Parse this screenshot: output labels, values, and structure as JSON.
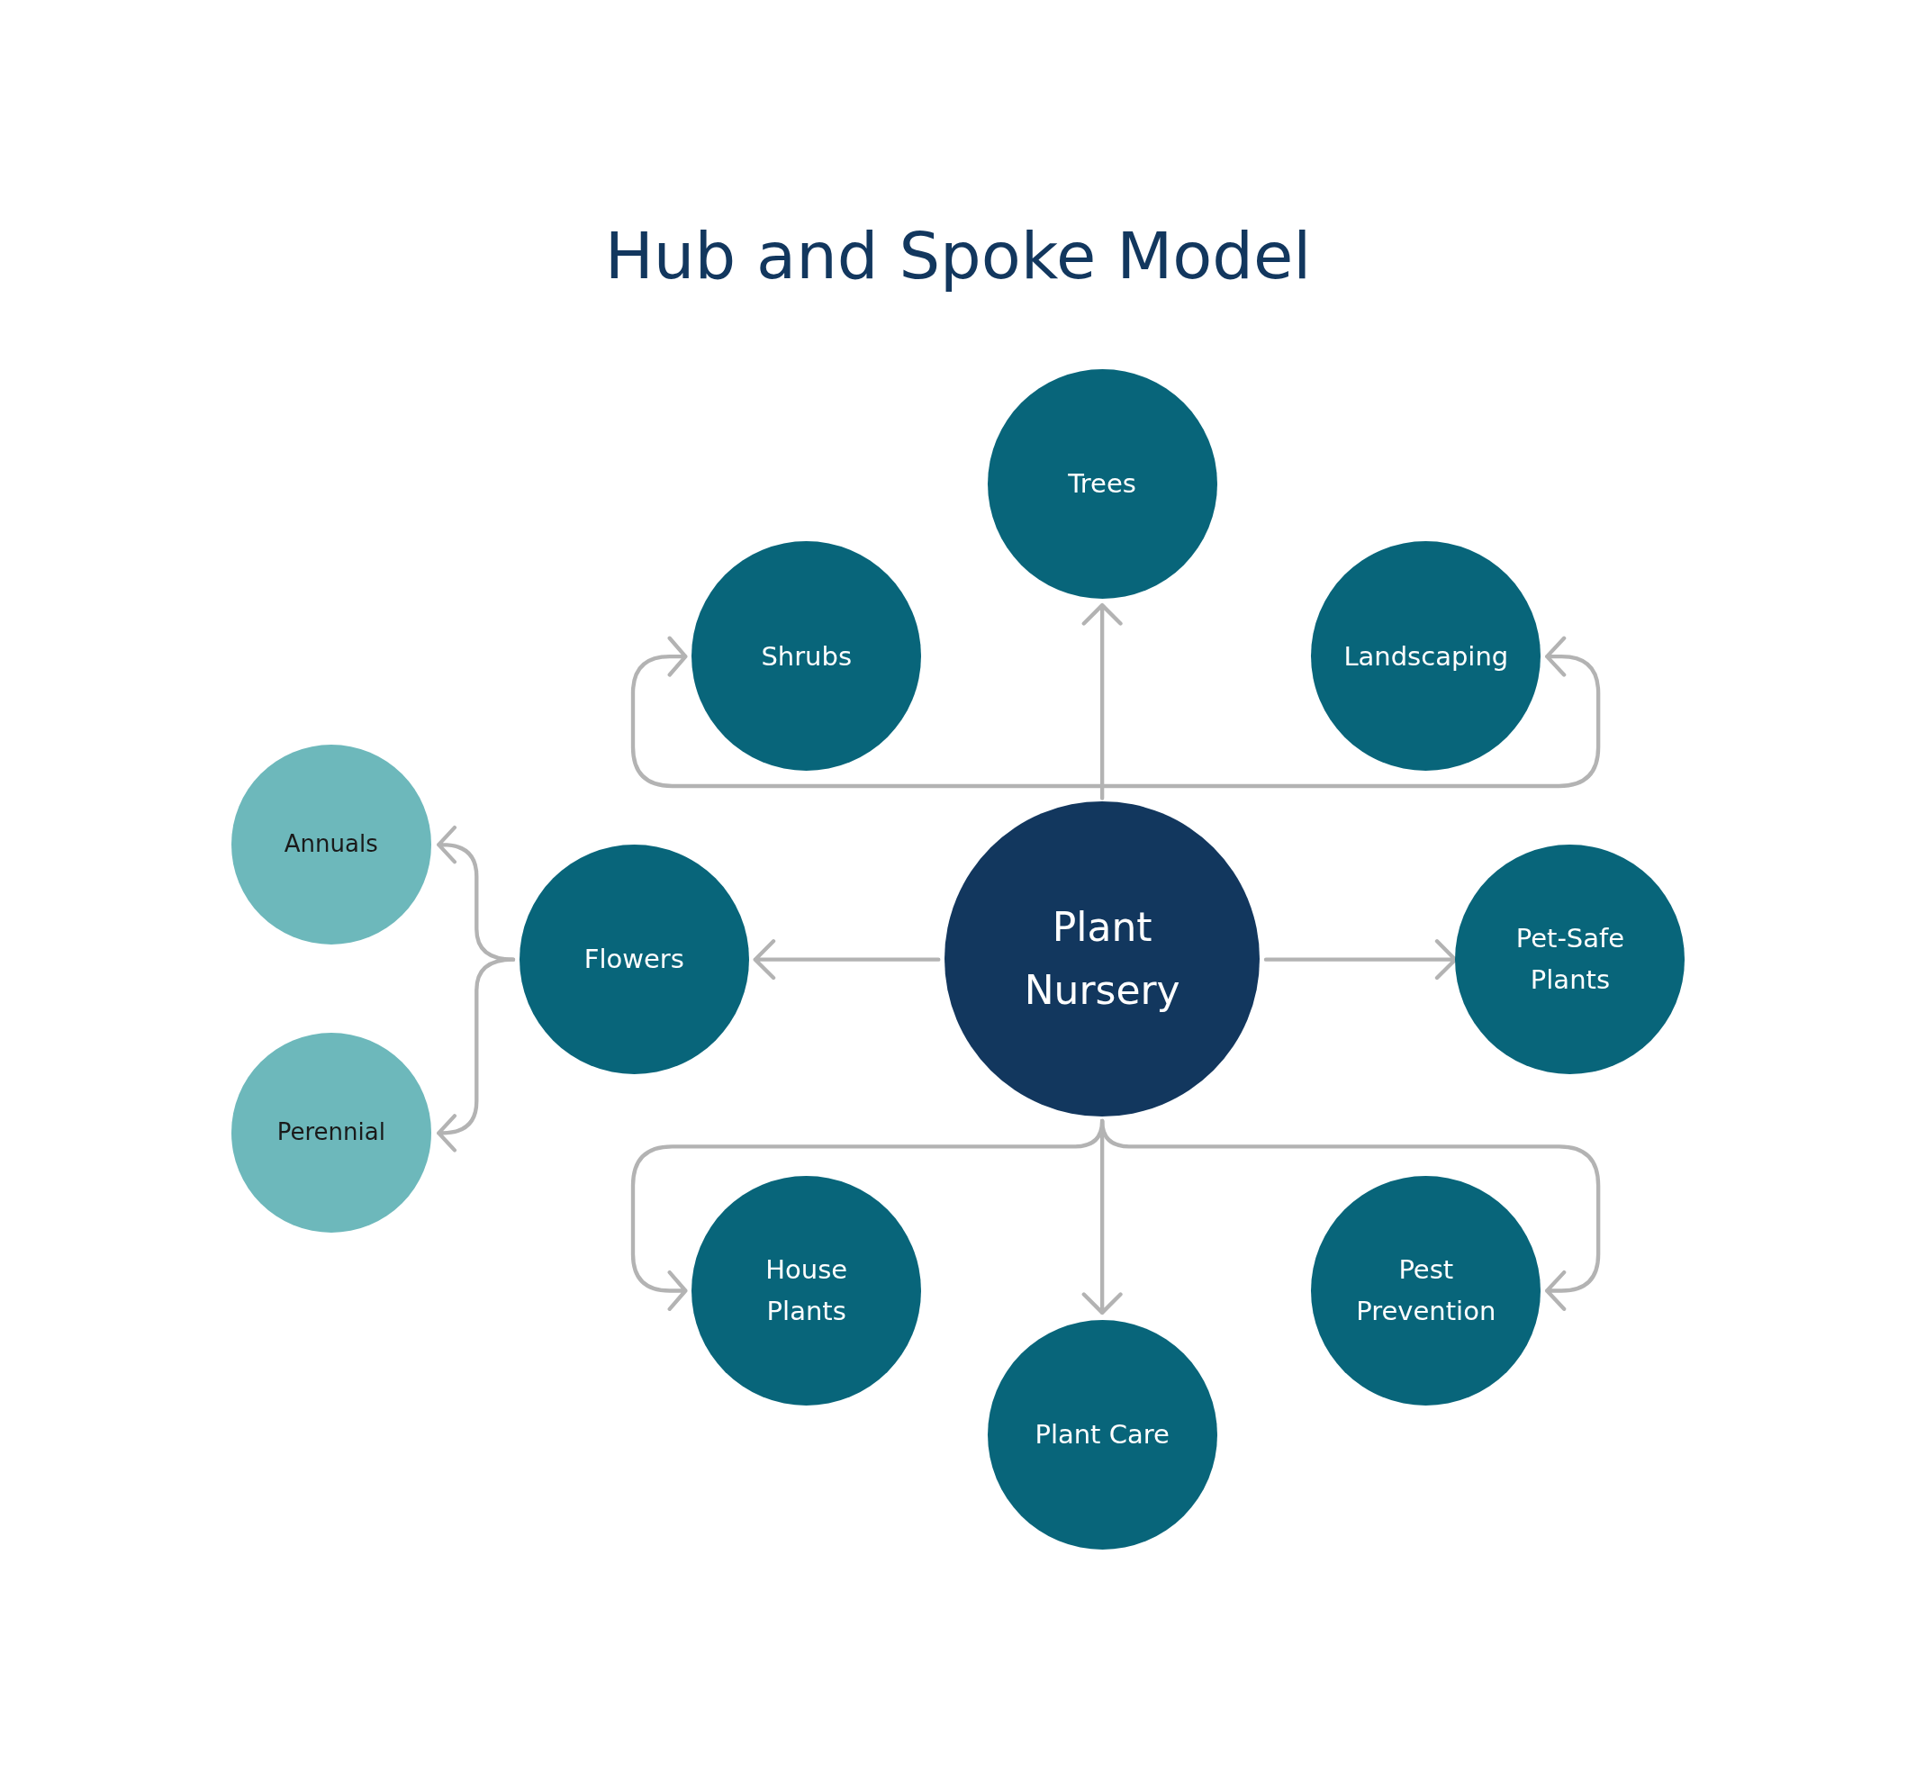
{
  "title": "Hub and Spoke Model",
  "hub": {
    "label": "Plant\nNursery",
    "color": "#12375e"
  },
  "spokes": [
    {
      "label": "Trees",
      "color": "#08657a"
    },
    {
      "label": "Shrubs",
      "color": "#08657a"
    },
    {
      "label": "Landscaping",
      "color": "#08657a"
    },
    {
      "label": "Flowers",
      "color": "#08657a",
      "children": [
        {
          "label": "Annuals",
          "color": "#6db8bb"
        },
        {
          "label": "Perennial",
          "color": "#6db8bb"
        }
      ]
    },
    {
      "label": "Pet-Safe\nPlants",
      "color": "#08657a"
    },
    {
      "label": "House\nPlants",
      "color": "#08657a"
    },
    {
      "label": "Plant Care",
      "color": "#08657a"
    },
    {
      "label": "Pest\nPrevention",
      "color": "#08657a"
    }
  ]
}
